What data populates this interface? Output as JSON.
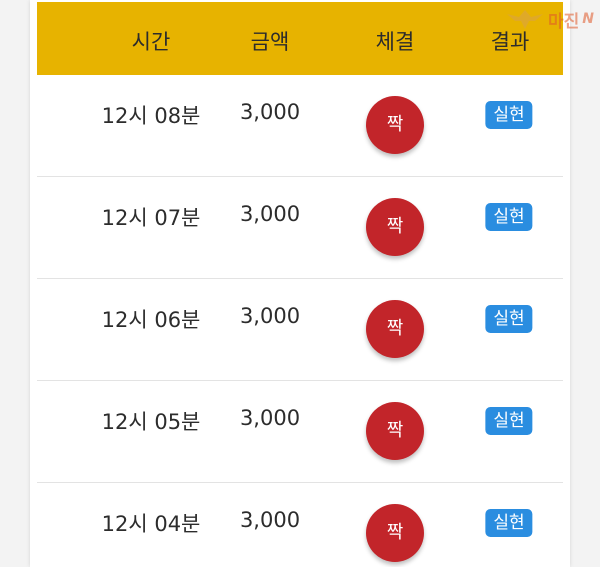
{
  "header": {
    "time": "시간",
    "amount": "금액",
    "bet": "체결",
    "result": "결과"
  },
  "rows": [
    {
      "time": "12시 08분",
      "amount": "3,000",
      "bet": "짝",
      "result": "실현"
    },
    {
      "time": "12시 07분",
      "amount": "3,000",
      "bet": "짝",
      "result": "실현"
    },
    {
      "time": "12시 06분",
      "amount": "3,000",
      "bet": "짝",
      "result": "실현"
    },
    {
      "time": "12시 05분",
      "amount": "3,000",
      "bet": "짝",
      "result": "실현"
    },
    {
      "time": "12시 04분",
      "amount": "3,000",
      "bet": "짝",
      "result": "실현"
    }
  ],
  "watermark": {
    "text": "마진",
    "suffix": "N"
  },
  "colors": {
    "header_bg": "#e7b300",
    "bet_circle": "#c2252a",
    "result_badge": "#2a8de0"
  }
}
